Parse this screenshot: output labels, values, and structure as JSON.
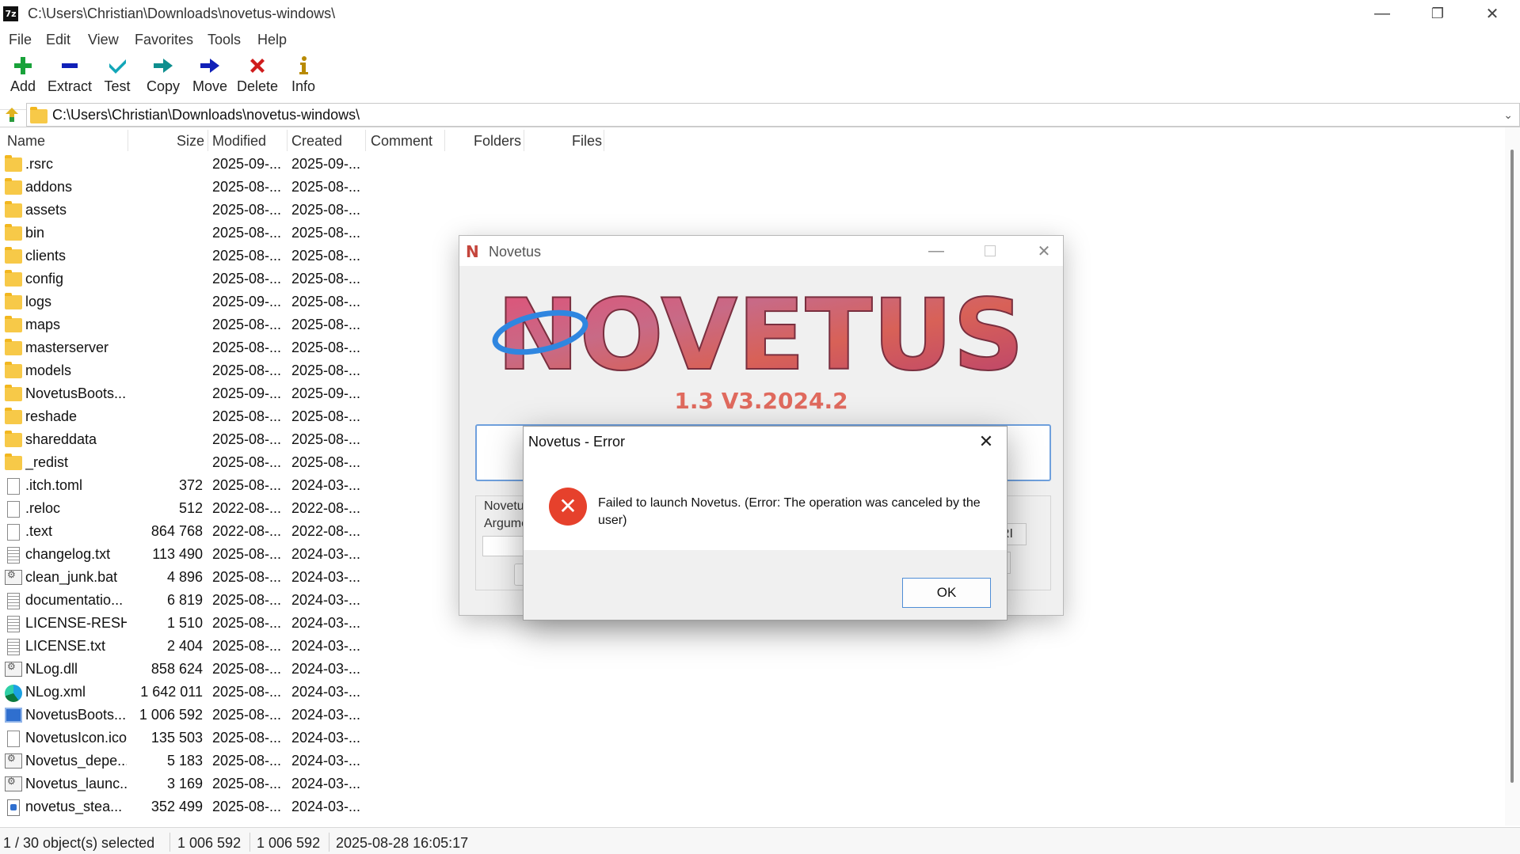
{
  "window": {
    "title": "C:\\Users\\Christian\\Downloads\\novetus-windows\\",
    "app_icon_text": "7z",
    "controls": {
      "minimize": "—",
      "maximize": "❐",
      "close": "✕"
    }
  },
  "menu": [
    "File",
    "Edit",
    "View",
    "Favorites",
    "Tools",
    "Help"
  ],
  "toolbar": {
    "add": "Add",
    "extract": "Extract",
    "test": "Test",
    "copy": "Copy",
    "move": "Move",
    "delete": "Delete",
    "info": "Info"
  },
  "address": {
    "path": "C:\\Users\\Christian\\Downloads\\novetus-windows\\"
  },
  "columns": {
    "name": "Name",
    "size": "Size",
    "modified": "Modified",
    "created": "Created",
    "comment": "Comment",
    "folders": "Folders",
    "files": "Files"
  },
  "files": [
    {
      "icon": "folder-icon",
      "name": ".rsrc",
      "size": "",
      "modified": "2025-09-...",
      "created": "2025-09-..."
    },
    {
      "icon": "folder-icon",
      "name": "addons",
      "size": "",
      "modified": "2025-08-...",
      "created": "2025-08-..."
    },
    {
      "icon": "folder-icon",
      "name": "assets",
      "size": "",
      "modified": "2025-08-...",
      "created": "2025-08-..."
    },
    {
      "icon": "folder-icon",
      "name": "bin",
      "size": "",
      "modified": "2025-08-...",
      "created": "2025-08-..."
    },
    {
      "icon": "folder-icon",
      "name": "clients",
      "size": "",
      "modified": "2025-08-...",
      "created": "2025-08-..."
    },
    {
      "icon": "folder-icon",
      "name": "config",
      "size": "",
      "modified": "2025-08-...",
      "created": "2025-08-..."
    },
    {
      "icon": "folder-icon",
      "name": "logs",
      "size": "",
      "modified": "2025-09-...",
      "created": "2025-08-..."
    },
    {
      "icon": "folder-icon",
      "name": "maps",
      "size": "",
      "modified": "2025-08-...",
      "created": "2025-08-..."
    },
    {
      "icon": "folder-icon",
      "name": "masterserver",
      "size": "",
      "modified": "2025-08-...",
      "created": "2025-08-..."
    },
    {
      "icon": "folder-icon",
      "name": "models",
      "size": "",
      "modified": "2025-08-...",
      "created": "2025-08-..."
    },
    {
      "icon": "folder-icon",
      "name": "NovetusBoots...",
      "size": "",
      "modified": "2025-09-...",
      "created": "2025-09-..."
    },
    {
      "icon": "folder-icon",
      "name": "reshade",
      "size": "",
      "modified": "2025-08-...",
      "created": "2025-08-..."
    },
    {
      "icon": "folder-icon",
      "name": "shareddata",
      "size": "",
      "modified": "2025-08-...",
      "created": "2025-08-..."
    },
    {
      "icon": "folder-icon",
      "name": "_redist",
      "size": "",
      "modified": "2025-08-...",
      "created": "2025-08-..."
    },
    {
      "icon": "file-icon",
      "name": ".itch.toml",
      "size": "372",
      "modified": "2025-08-...",
      "created": "2024-03-..."
    },
    {
      "icon": "file-icon",
      "name": ".reloc",
      "size": "512",
      "modified": "2022-08-...",
      "created": "2022-08-..."
    },
    {
      "icon": "file-icon",
      "name": ".text",
      "size": "864 768",
      "modified": "2022-08-...",
      "created": "2022-08-..."
    },
    {
      "icon": "text-file-icon",
      "name": "changelog.txt",
      "size": "113 490",
      "modified": "2025-08-...",
      "created": "2024-03-..."
    },
    {
      "icon": "batch-file-icon",
      "name": "clean_junk.bat",
      "size": "4 896",
      "modified": "2025-08-...",
      "created": "2024-03-..."
    },
    {
      "icon": "text-file-icon",
      "name": "documentatio...",
      "size": "6 819",
      "modified": "2025-08-...",
      "created": "2024-03-..."
    },
    {
      "icon": "text-file-icon",
      "name": "LICENSE-RESH...",
      "size": "1 510",
      "modified": "2025-08-...",
      "created": "2024-03-..."
    },
    {
      "icon": "text-file-icon",
      "name": "LICENSE.txt",
      "size": "2 404",
      "modified": "2025-08-...",
      "created": "2024-03-..."
    },
    {
      "icon": "batch-file-icon",
      "name": "NLog.dll",
      "size": "858 624",
      "modified": "2025-08-...",
      "created": "2024-03-..."
    },
    {
      "icon": "edge-browser-icon",
      "name": "NLog.xml",
      "size": "1 642 011",
      "modified": "2025-08-...",
      "created": "2024-03-..."
    },
    {
      "icon": "executable-icon",
      "name": "NovetusBoots...",
      "size": "1 006 592",
      "modified": "2025-08-...",
      "created": "2024-03-..."
    },
    {
      "icon": "file-icon",
      "name": "NovetusIcon.ico",
      "size": "135 503",
      "modified": "2025-08-...",
      "created": "2024-03-..."
    },
    {
      "icon": "batch-file-icon",
      "name": "Novetus_depe...",
      "size": "5 183",
      "modified": "2025-08-...",
      "created": "2024-03-..."
    },
    {
      "icon": "batch-file-icon",
      "name": "Novetus_launc...",
      "size": "3 169",
      "modified": "2025-08-...",
      "created": "2024-03-..."
    },
    {
      "icon": "script-file-icon",
      "name": "novetus_stea...",
      "size": "352 499",
      "modified": "2025-08-...",
      "created": "2024-03-..."
    }
  ],
  "status": {
    "selection": "1 / 30 object(s) selected",
    "size": "1 006 592",
    "packed": "1 006 592",
    "date": "2025-08-28 16:05:17"
  },
  "novetus": {
    "title": "Novetus",
    "logo_text": "NOVETUS",
    "version": "1.3 V3.2024.2",
    "label_1": "Novetu",
    "label_2": "Argume",
    "side_button": "RI"
  },
  "error_dialog": {
    "title": "Novetus - Error",
    "message": "Failed to launch Novetus. (Error: The operation was canceled by the user)",
    "ok": "OK",
    "icon_glyph": "✕"
  },
  "colors": {
    "folder": "#f7c948",
    "error_red": "#e6412c",
    "novetus_logo": "#d8516a",
    "version_text": "#e06a5e",
    "focus_blue": "#4f8ed6"
  }
}
